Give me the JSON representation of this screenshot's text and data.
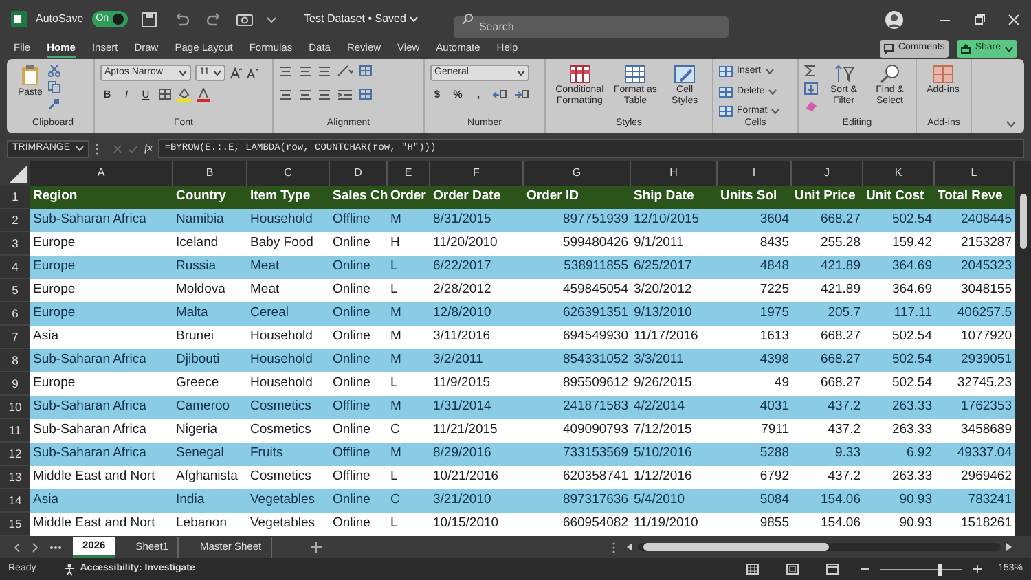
{
  "title_bar": {
    "autosave_label": "AutoSave",
    "autosave": {
      "on": true,
      "label": "On"
    },
    "document_title": "Test Dataset • Saved",
    "search_placeholder": "Search"
  },
  "menu_tabs": [
    {
      "label": "File",
      "selected": false
    },
    {
      "label": "Home",
      "selected": true
    },
    {
      "label": "Insert",
      "selected": false
    },
    {
      "label": "Draw",
      "selected": false
    },
    {
      "label": "Page Layout",
      "selected": false
    },
    {
      "label": "Formulas",
      "selected": false
    },
    {
      "label": "Data",
      "selected": false
    },
    {
      "label": "Review",
      "selected": false
    },
    {
      "label": "View",
      "selected": false
    },
    {
      "label": "Automate",
      "selected": false
    },
    {
      "label": "Help",
      "selected": false
    }
  ],
  "comments_button": "Comments",
  "share_button": "Share",
  "ribbon": [
    {
      "kind": "clipboard",
      "label": "Clipboard",
      "paste": "Paste"
    },
    {
      "kind": "font",
      "label": "Font",
      "font_name": "Aptos Narrow",
      "font_size": "11",
      "style_buttons": [
        "B",
        "I",
        "U"
      ]
    },
    {
      "kind": "alignment",
      "label": "Alignment"
    },
    {
      "kind": "number",
      "label": "Number",
      "format": "General",
      "symbols": [
        "$",
        "%",
        ","
      ]
    },
    {
      "kind": "styles",
      "label": "Styles",
      "buttons": [
        "Conditional Formatting",
        "Format as Table",
        "Cell Styles"
      ]
    },
    {
      "kind": "cells",
      "label": "Cells",
      "buttons": [
        "Insert",
        "Delete",
        "Format"
      ]
    },
    {
      "kind": "editing",
      "label": "Editing",
      "buttons": [
        "Sort & Filter",
        "Find & Select"
      ]
    },
    {
      "kind": "addins",
      "label": "Add-ins",
      "buttons": [
        "Add-ins"
      ]
    }
  ],
  "formula_bar": {
    "name_box": "TRIMRANGE",
    "fx_label": "fx",
    "formula": "=BYROW(E.:.E, LAMBDA(row, COUNTCHAR(row, \"H\")))"
  },
  "columns": [
    "A",
    "B",
    "C",
    "D",
    "E",
    "F",
    "G",
    "H",
    "I",
    "J",
    "K",
    "L"
  ],
  "rows": [
    {
      "number": "1",
      "kind": "header",
      "cells": [
        "Region",
        "Country",
        "Item Type",
        "Sales Ch",
        "Order",
        "Order Date",
        "Order ID",
        "Ship Date",
        "Units Sol",
        "Unit Price",
        "Unit Cost",
        "Total Reve"
      ]
    },
    {
      "number": "2",
      "kind": "banded",
      "cells": [
        "Sub-Saharan Africa",
        "Namibia",
        "Household",
        "Offline",
        "M",
        "8/31/2015",
        "897751939",
        "12/10/2015",
        "3604",
        "668.27",
        "502.54",
        "2408445"
      ]
    },
    {
      "number": "3",
      "kind": "plain",
      "cells": [
        "Europe",
        "Iceland",
        "Baby Food",
        "Online",
        "H",
        "11/20/2010",
        "599480426",
        "9/1/2011",
        "8435",
        "255.28",
        "159.42",
        "2153287"
      ]
    },
    {
      "number": "4",
      "kind": "banded",
      "cells": [
        "Europe",
        "Russia",
        "Meat",
        "Online",
        "L",
        "6/22/2017",
        "538911855",
        "6/25/2017",
        "4848",
        "421.89",
        "364.69",
        "2045323"
      ]
    },
    {
      "number": "5",
      "kind": "plain",
      "cells": [
        "Europe",
        "Moldova",
        "Meat",
        "Online",
        "L",
        "2/28/2012",
        "459845054",
        "3/20/2012",
        "7225",
        "421.89",
        "364.69",
        "3048155"
      ]
    },
    {
      "number": "6",
      "kind": "banded",
      "cells": [
        "Europe",
        "Malta",
        "Cereal",
        "Online",
        "M",
        "12/8/2010",
        "626391351",
        "9/13/2010",
        "1975",
        "205.7",
        "117.11",
        "406257.5"
      ]
    },
    {
      "number": "7",
      "kind": "plain",
      "cells": [
        "Asia",
        "Brunei",
        "Household",
        "Online",
        "M",
        "3/11/2016",
        "694549930",
        "11/17/2016",
        "1613",
        "668.27",
        "502.54",
        "1077920"
      ]
    },
    {
      "number": "8",
      "kind": "banded",
      "cells": [
        "Sub-Saharan Africa",
        "Djibouti",
        "Household",
        "Online",
        "M",
        "3/2/2011",
        "854331052",
        "3/3/2011",
        "4398",
        "668.27",
        "502.54",
        "2939051"
      ]
    },
    {
      "number": "9",
      "kind": "plain",
      "cells": [
        "Europe",
        "Greece",
        "Household",
        "Online",
        "L",
        "11/9/2015",
        "895509612",
        "9/26/2015",
        "49",
        "668.27",
        "502.54",
        "32745.23"
      ]
    },
    {
      "number": "10",
      "kind": "banded",
      "cells": [
        "Sub-Saharan Africa",
        "Cameroo",
        "Cosmetics",
        "Offline",
        "M",
        "1/31/2014",
        "241871583",
        "4/2/2014",
        "4031",
        "437.2",
        "263.33",
        "1762353"
      ]
    },
    {
      "number": "11",
      "kind": "plain",
      "cells": [
        "Sub-Saharan Africa",
        "Nigeria",
        "Cosmetics",
        "Online",
        "C",
        "11/21/2015",
        "409090793",
        "7/12/2015",
        "7911",
        "437.2",
        "263.33",
        "3458689"
      ]
    },
    {
      "number": "12",
      "kind": "banded",
      "cells": [
        "Sub-Saharan Africa",
        "Senegal",
        "Fruits",
        "Offline",
        "M",
        "8/29/2016",
        "733153569",
        "5/10/2016",
        "5288",
        "9.33",
        "6.92",
        "49337.04"
      ]
    },
    {
      "number": "13",
      "kind": "plain",
      "cells": [
        "Middle East and Nort",
        "Afghanista",
        "Cosmetics",
        "Offline",
        "L",
        "10/21/2016",
        "620358741",
        "1/12/2016",
        "6792",
        "437.2",
        "263.33",
        "2969462"
      ]
    },
    {
      "number": "14",
      "kind": "banded",
      "cells": [
        "Asia",
        "India",
        "Vegetables",
        "Online",
        "C",
        "3/21/2010",
        "897317636",
        "5/4/2010",
        "5084",
        "154.06",
        "90.93",
        "783241"
      ]
    },
    {
      "number": "15",
      "kind": "plain",
      "cells": [
        "Middle East and Nort",
        "Lebanon",
        "Vegetables",
        "Online",
        "L",
        "10/15/2010",
        "660954082",
        "11/19/2010",
        "9855",
        "154.06",
        "90.93",
        "1518261"
      ]
    }
  ],
  "sheet_tabs": [
    {
      "label": "2026",
      "selected": true
    },
    {
      "label": "Sheet1",
      "selected": false
    },
    {
      "label": "Master Sheet",
      "selected": false
    }
  ],
  "status_bar": {
    "ready": "Ready",
    "accessibility": "Accessibility: Investigate",
    "zoom": {
      "level": 0.72,
      "reading": "153%"
    }
  }
}
